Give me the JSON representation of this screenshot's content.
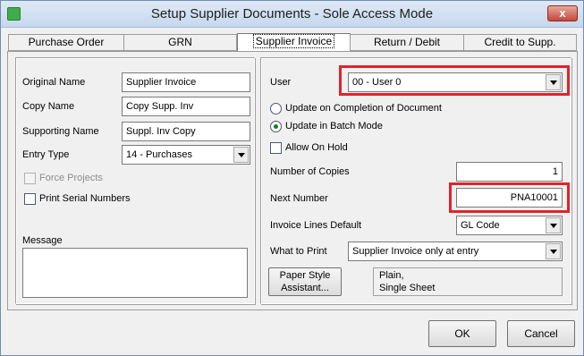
{
  "window": {
    "title": "Setup Supplier Documents - Sole Access Mode",
    "close_glyph": "x"
  },
  "tabs": [
    {
      "label": "Purchase Order"
    },
    {
      "label": "GRN"
    },
    {
      "label": "Supplier Invoice"
    },
    {
      "label": "Return / Debit"
    },
    {
      "label": "Credit to Supp."
    }
  ],
  "left": {
    "original_name": {
      "label": "Original Name",
      "value": "Supplier Invoice"
    },
    "copy_name": {
      "label": "Copy Name",
      "value": "Copy Supp. Inv"
    },
    "supporting_name": {
      "label": "Supporting Name",
      "value": "Suppl. Inv Copy"
    },
    "entry_type": {
      "label": "Entry Type",
      "value": "14 -   Purchases"
    },
    "force_projects": {
      "label": "Force Projects"
    },
    "print_serial": {
      "label": "Print Serial Numbers"
    },
    "message": {
      "label": "Message"
    }
  },
  "right": {
    "user": {
      "label": "User",
      "value": "00 - User 0"
    },
    "update_completion": {
      "label": "Update on Completion of Document"
    },
    "update_batch": {
      "label": "Update in Batch Mode"
    },
    "allow_on_hold": {
      "label": "Allow On Hold"
    },
    "copies": {
      "label": "Number of Copies",
      "value": "1"
    },
    "next_number": {
      "label": "Next Number",
      "value": "PNA10001"
    },
    "invoice_lines": {
      "label": "Invoice Lines Default",
      "value": "GL Code"
    },
    "what_to_print": {
      "label": "What to Print",
      "value": "Supplier Invoice only at entry"
    },
    "paper_style": {
      "label_line1": "Paper Style",
      "label_line2": "Assistant...",
      "desc_line1": "Plain,",
      "desc_line2": "Single Sheet"
    }
  },
  "buttons": {
    "ok": "OK",
    "cancel": "Cancel"
  },
  "colors": {
    "highlight": "#e0242b",
    "title_bg": "#c6d8ee",
    "close_bg": "#c7463a"
  }
}
